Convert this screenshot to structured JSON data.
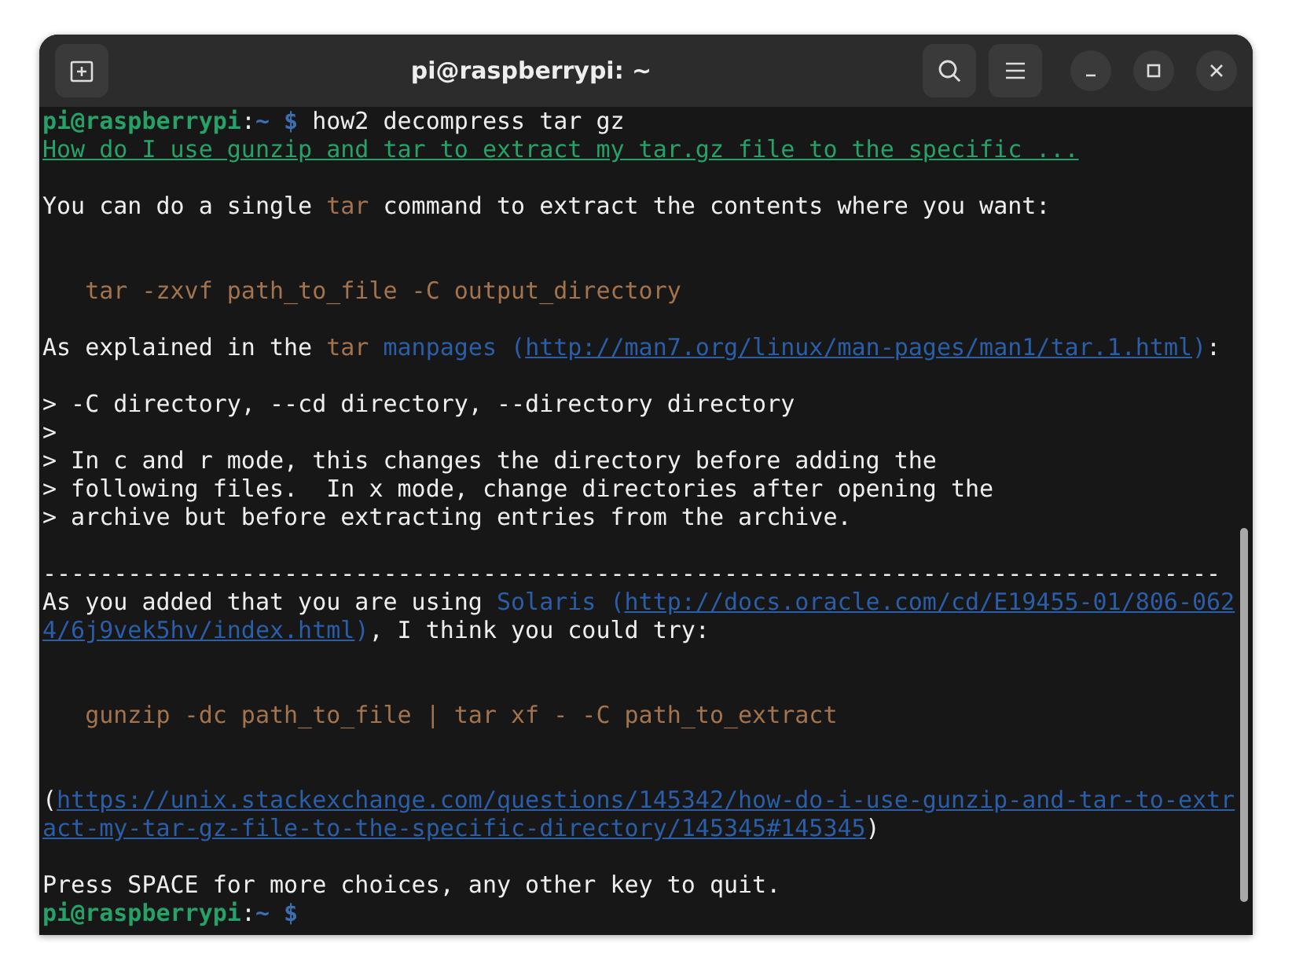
{
  "window": {
    "title": "pi@raspberrypi: ~"
  },
  "terminal": {
    "lines": [
      {
        "kind": "line",
        "spans": [
          {
            "text": "pi@raspberrypi",
            "kind": "user"
          },
          {
            "text": ":",
            "kind": "plain"
          },
          {
            "text": "~ $",
            "kind": "path"
          },
          {
            "text": " how2 decompress tar gz",
            "kind": "plain"
          }
        ]
      },
      {
        "kind": "line",
        "spans": [
          {
            "text": "How do I use gunzip and tar to extract my tar.gz file to the specific ...",
            "kind": "title_link"
          }
        ]
      },
      {
        "kind": "blank"
      },
      {
        "kind": "line",
        "spans": [
          {
            "text": "You can do a single ",
            "kind": "plain"
          },
          {
            "text": "tar",
            "kind": "code"
          },
          {
            "text": " command to extract the contents where you want:",
            "kind": "plain"
          }
        ]
      },
      {
        "kind": "blank"
      },
      {
        "kind": "blank"
      },
      {
        "kind": "line",
        "spans": [
          {
            "text": "   tar -zxvf path_to_file -C output_directory",
            "kind": "code"
          }
        ]
      },
      {
        "kind": "blank"
      },
      {
        "kind": "line",
        "spans": [
          {
            "text": "As explained in the ",
            "kind": "plain"
          },
          {
            "text": "tar",
            "kind": "code"
          },
          {
            "text": " manpages (",
            "kind": "ref"
          },
          {
            "text": "http://man7.org/linux/man-pages/man1/tar.1.html",
            "kind": "url"
          },
          {
            "text": ")",
            "kind": "ref"
          },
          {
            "text": ":",
            "kind": "plain"
          }
        ]
      },
      {
        "kind": "blank"
      },
      {
        "kind": "line",
        "spans": [
          {
            "text": "> -C directory, --cd directory, --directory directory",
            "kind": "plain"
          }
        ]
      },
      {
        "kind": "line",
        "spans": [
          {
            "text": ">",
            "kind": "plain"
          }
        ]
      },
      {
        "kind": "line",
        "spans": [
          {
            "text": "> In c and r mode, this changes the directory before adding the",
            "kind": "plain"
          }
        ]
      },
      {
        "kind": "line",
        "spans": [
          {
            "text": "> following files.  In x mode, change directories after opening the",
            "kind": "plain"
          }
        ]
      },
      {
        "kind": "line",
        "spans": [
          {
            "text": "> archive but before extracting entries from the archive.",
            "kind": "plain"
          }
        ]
      },
      {
        "kind": "blank"
      },
      {
        "kind": "line",
        "spans": [
          {
            "text": "-----------------------------------------------------------------------------------",
            "kind": "plain"
          }
        ]
      },
      {
        "kind": "line",
        "spans": [
          {
            "text": "As you added that you are using ",
            "kind": "plain"
          },
          {
            "text": "Solaris (",
            "kind": "ref"
          },
          {
            "text": "http://docs.oracle.com/cd/E19455-01/806-062",
            "kind": "url"
          }
        ]
      },
      {
        "kind": "line",
        "spans": [
          {
            "text": "4/6j9vek5hv/index.html",
            "kind": "url"
          },
          {
            "text": ")",
            "kind": "ref"
          },
          {
            "text": ", I think you could try:",
            "kind": "plain"
          }
        ]
      },
      {
        "kind": "blank"
      },
      {
        "kind": "blank"
      },
      {
        "kind": "line",
        "spans": [
          {
            "text": "   gunzip -dc path_to_file | tar xf - -C path_to_extract",
            "kind": "code"
          }
        ]
      },
      {
        "kind": "blank"
      },
      {
        "kind": "blank"
      },
      {
        "kind": "line",
        "spans": [
          {
            "text": "(",
            "kind": "plain"
          },
          {
            "text": "https://unix.stackexchange.com/questions/145342/how-do-i-use-gunzip-and-tar-to-extr",
            "kind": "url"
          }
        ]
      },
      {
        "kind": "line",
        "spans": [
          {
            "text": "act-my-tar-gz-file-to-the-specific-directory/145345#145345",
            "kind": "url"
          },
          {
            "text": ")",
            "kind": "plain"
          }
        ]
      },
      {
        "kind": "blank"
      },
      {
        "kind": "line",
        "spans": [
          {
            "text": "Press SPACE for more choices, any other key to quit.",
            "kind": "plain"
          }
        ]
      },
      {
        "kind": "line",
        "spans": [
          {
            "text": "pi@raspberrypi",
            "kind": "user"
          },
          {
            "text": ":",
            "kind": "plain"
          },
          {
            "text": "~ $",
            "kind": "path"
          }
        ]
      }
    ]
  }
}
